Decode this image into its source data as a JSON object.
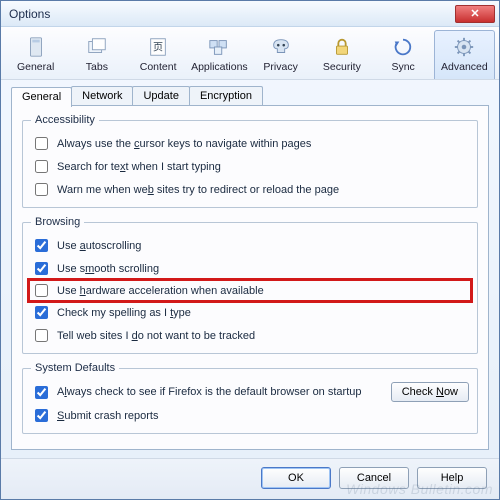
{
  "window": {
    "title": "Options"
  },
  "toolbar": {
    "items": [
      {
        "label": "General"
      },
      {
        "label": "Tabs"
      },
      {
        "label": "Content"
      },
      {
        "label": "Applications"
      },
      {
        "label": "Privacy"
      },
      {
        "label": "Security"
      },
      {
        "label": "Sync"
      },
      {
        "label": "Advanced"
      }
    ]
  },
  "tabs": {
    "items": [
      {
        "label": "General"
      },
      {
        "label": "Network"
      },
      {
        "label": "Update"
      },
      {
        "label": "Encryption"
      }
    ]
  },
  "groups": {
    "accessibility": {
      "legend": "Accessibility",
      "items": [
        {
          "label_pre": "Always use the ",
          "u": "c",
          "label_post": "ursor keys to navigate within pages",
          "checked": false
        },
        {
          "label_pre": "Search for te",
          "u": "x",
          "label_post": "t when I start typing",
          "checked": false
        },
        {
          "label_pre": "Warn me when we",
          "u": "b",
          "label_post": " sites try to redirect or reload the page",
          "checked": false
        }
      ]
    },
    "browsing": {
      "legend": "Browsing",
      "items": [
        {
          "label_pre": "Use ",
          "u": "a",
          "label_post": "utoscrolling",
          "checked": true
        },
        {
          "label_pre": "Use s",
          "u": "m",
          "label_post": "ooth scrolling",
          "checked": true
        },
        {
          "label_pre": "Use ",
          "u": "h",
          "label_post": "ardware acceleration when available",
          "checked": false,
          "highlight": true
        },
        {
          "label_pre": "Check my spelling as I ",
          "u": "t",
          "label_post": "ype",
          "checked": true
        },
        {
          "label_pre": "Tell web sites I ",
          "u": "d",
          "label_post": "o not want to be tracked",
          "checked": false
        }
      ]
    },
    "system": {
      "legend": "System Defaults",
      "items": [
        {
          "label_pre": "A",
          "u": "l",
          "label_post": "ways check to see if Firefox is the default browser on startup",
          "checked": true
        },
        {
          "label_pre": "",
          "u": "S",
          "label_post": "ubmit crash reports",
          "checked": true
        }
      ],
      "check_now_pre": "Check ",
      "check_now_u": "N",
      "check_now_post": "ow"
    }
  },
  "footer": {
    "ok": "OK",
    "cancel": "Cancel",
    "help": "Help"
  },
  "watermark": "Windows Bulletin.com"
}
